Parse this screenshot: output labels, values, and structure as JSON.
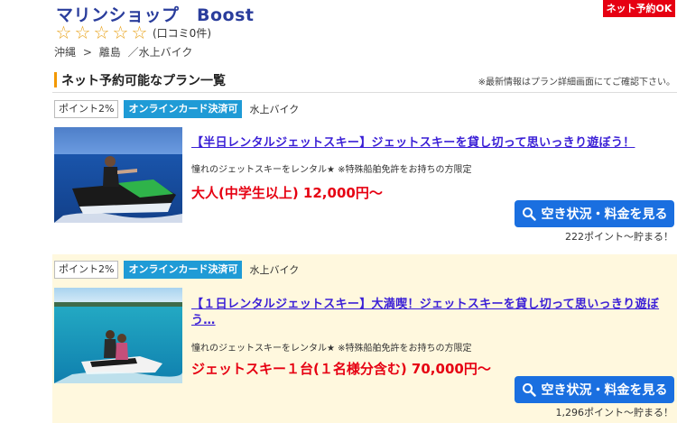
{
  "shop": {
    "title": "マリンショップ　Boost",
    "net_badge": "ネット予約OK",
    "review_label": "(口コミ0件)",
    "stars_filled": 0,
    "stars_total": 5
  },
  "breadcrumb": [
    "沖縄",
    ">",
    "離島",
    "／水上バイク"
  ],
  "section": {
    "title": "ネット予約可能なプラン一覧",
    "note": "※最新情報はプラン詳細画面にてご確認下さい。"
  },
  "plans": [
    {
      "point_tag": "ポイント2%",
      "card_tag": "オンラインカード決済可",
      "category": "水上バイク",
      "title": "【半日レンタルジェットスキー】ジェットスキーを貸し切って思いっきり遊ぼう！",
      "description": "憧れのジェットスキーをレンタル★ ※特殊船舶免許をお持ちの方限定",
      "price": "大人(中学生以上) 12,000円〜",
      "button": "空き状況・料金を見る",
      "points": "222ポイント〜貯まる！"
    },
    {
      "point_tag": "ポイント2%",
      "card_tag": "オンラインカード決済可",
      "category": "水上バイク",
      "title": "【１日レンタルジェットスキー】大満喫！ジェットスキーを貸し切って思いっきり遊ぼう…",
      "description": "憧れのジェットスキーをレンタル★ ※特殊船舶免許をお持ちの方限定",
      "price": "ジェットスキー１台(１名様分含む) 70,000円〜",
      "button": "空き状況・料金を見る",
      "points": "1,296ポイント〜貯まる！"
    }
  ],
  "colors": {
    "title_blue": "#2a3d9c",
    "badge_red": "#e60012",
    "star_orange": "#e9a41f",
    "accent_orange": "#f39800",
    "card_tag_blue": "#1f9bd6",
    "link_purple": "#3a1fd6",
    "price_red": "#e60012",
    "button_blue": "#1a6fe0",
    "highlight_bg": "#fff8de"
  }
}
